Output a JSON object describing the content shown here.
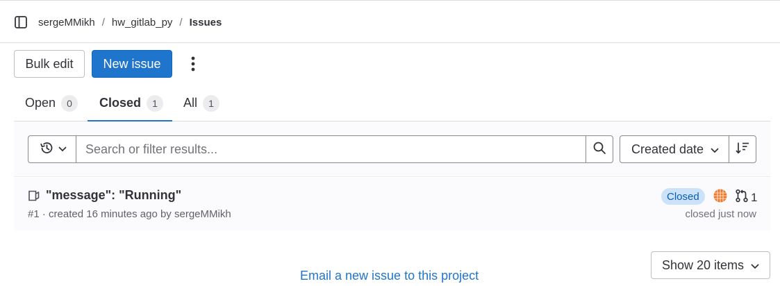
{
  "breadcrumb": {
    "items": [
      "sergeMMikh",
      "hw_gitlab_py"
    ],
    "current": "Issues",
    "separator": "/"
  },
  "actions": {
    "bulk_edit": "Bulk edit",
    "new_issue": "New issue"
  },
  "tabs": [
    {
      "label": "Open",
      "count": "0"
    },
    {
      "label": "Closed",
      "count": "1",
      "active": true
    },
    {
      "label": "All",
      "count": "1"
    }
  ],
  "filter": {
    "search_placeholder": "Search or filter results...",
    "sort_label": "Created date"
  },
  "issue": {
    "title": "\"message\": \"Running\"",
    "ref": "#1",
    "created": "created 16 minutes ago by",
    "author": "sergeMMikh",
    "status": "Closed",
    "mr_count": "1",
    "closed_time": "closed just now"
  },
  "footer": {
    "email_link": "Email a new issue to this project",
    "page_size": "Show 20 items"
  },
  "colors": {
    "primary": "#1f75cb",
    "badge_bg": "#cbe2f9",
    "badge_text": "#0b5cad",
    "avatar": "#e8792f"
  },
  "icons": [
    "sidebar-toggle-icon",
    "kebab-menu-icon",
    "history-icon",
    "chevron-down-icon",
    "search-icon",
    "sort-descending-icon",
    "issue-closed-icon",
    "avatar",
    "merge-request-icon"
  ]
}
